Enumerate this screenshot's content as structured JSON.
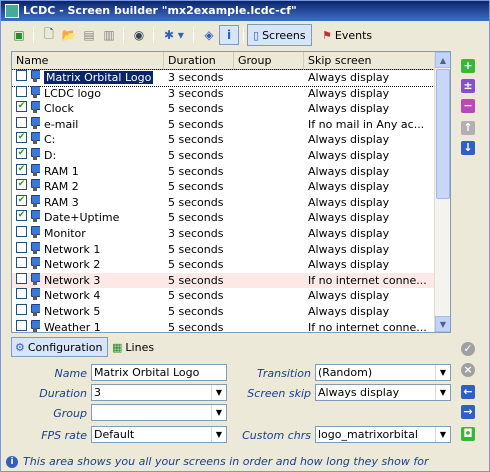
{
  "window": {
    "title": "LCDC - Screen builder \"mx2example.lcdc-cf\""
  },
  "toolbar": {
    "screens_label": "Screens",
    "events_label": "Events"
  },
  "table": {
    "headers": {
      "name": "Name",
      "duration": "Duration",
      "group": "Group",
      "skip": "Skip screen"
    },
    "rows": [
      {
        "checked": false,
        "name": "Matrix Orbital Logo",
        "duration": "3 seconds",
        "group": "",
        "skip": "Always display"
      },
      {
        "checked": false,
        "name": "LCDC logo",
        "duration": "3 seconds",
        "group": "",
        "skip": "Always display"
      },
      {
        "checked": true,
        "name": "Clock",
        "duration": "5 seconds",
        "group": "",
        "skip": "Always display"
      },
      {
        "checked": false,
        "name": "e-mail",
        "duration": "5 seconds",
        "group": "",
        "skip": "If no mail in Any ac..."
      },
      {
        "checked": true,
        "name": "C:",
        "duration": "5 seconds",
        "group": "",
        "skip": "Always display"
      },
      {
        "checked": true,
        "name": "D:",
        "duration": "5 seconds",
        "group": "",
        "skip": "Always display"
      },
      {
        "checked": true,
        "name": "RAM 1",
        "duration": "5 seconds",
        "group": "",
        "skip": "Always display"
      },
      {
        "checked": true,
        "name": "RAM 2",
        "duration": "5 seconds",
        "group": "",
        "skip": "Always display"
      },
      {
        "checked": true,
        "name": "RAM 3",
        "duration": "5 seconds",
        "group": "",
        "skip": "Always display"
      },
      {
        "checked": true,
        "name": "Date+Uptime",
        "duration": "5 seconds",
        "group": "",
        "skip": "Always display"
      },
      {
        "checked": false,
        "name": "Monitor",
        "duration": "3 seconds",
        "group": "",
        "skip": "Always display"
      },
      {
        "checked": false,
        "name": "Network 1",
        "duration": "5 seconds",
        "group": "",
        "skip": "Always display"
      },
      {
        "checked": false,
        "name": "Network 2",
        "duration": "5 seconds",
        "group": "",
        "skip": "Always display"
      },
      {
        "checked": false,
        "name": "Network 3",
        "duration": "5 seconds",
        "group": "",
        "skip": "If no internet conne..."
      },
      {
        "checked": false,
        "name": "Network 4",
        "duration": "5 seconds",
        "group": "",
        "skip": "Always display"
      },
      {
        "checked": false,
        "name": "Network 5",
        "duration": "5 seconds",
        "group": "",
        "skip": "Always display"
      },
      {
        "checked": false,
        "name": "Weather 1",
        "duration": "5 seconds",
        "group": "",
        "skip": "If no internet conne..."
      }
    ]
  },
  "bottom_tabs": {
    "configuration": "Configuration",
    "lines": "Lines"
  },
  "form": {
    "name_label": "Name",
    "name_value": "Matrix Orbital Logo",
    "duration_label": "Duration",
    "duration_value": "3",
    "group_label": "Group",
    "group_value": "",
    "fps_label": "FPS rate",
    "fps_value": "Default",
    "transition_label": "Transition",
    "transition_value": "(Random)",
    "skip_label": "Screen skip",
    "skip_value": "Always display",
    "chrs_label": "Custom chrs",
    "chrs_value": "logo_matrixorbital"
  },
  "status": {
    "text": "This area shows you all your screens in order and how long they show for"
  },
  "colors": {
    "selection": "#0a246a",
    "highlight_row": "#fde8e8",
    "add": "#38b838",
    "remove": "#b848b8",
    "arrow": "#2f5fbf"
  }
}
